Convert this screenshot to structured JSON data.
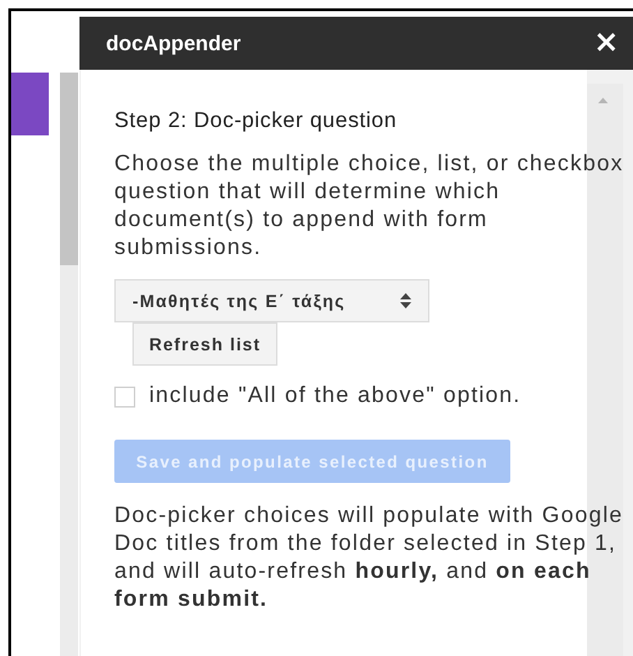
{
  "window": {
    "title": "docAppender",
    "close": "×"
  },
  "step_title": "Step 2: Doc-picker question",
  "description": "Choose the multiple choice, list, or checkbox question that will determine which document(s) to append with form submissions.",
  "question_select": {
    "value": "-Μαθητές της Ε΄ τάξης"
  },
  "refresh_button": "Refresh list",
  "all_option": {
    "label": "include \"All of the above\" option.",
    "checked": false
  },
  "save_button": {
    "label": "Save and populate selected question",
    "disabled": true
  },
  "note": "Doc-picker choices will populate with Google Doc titles from the folder selected in Step 1, and will auto-refresh **hourly,** and **on each form submit.**"
}
